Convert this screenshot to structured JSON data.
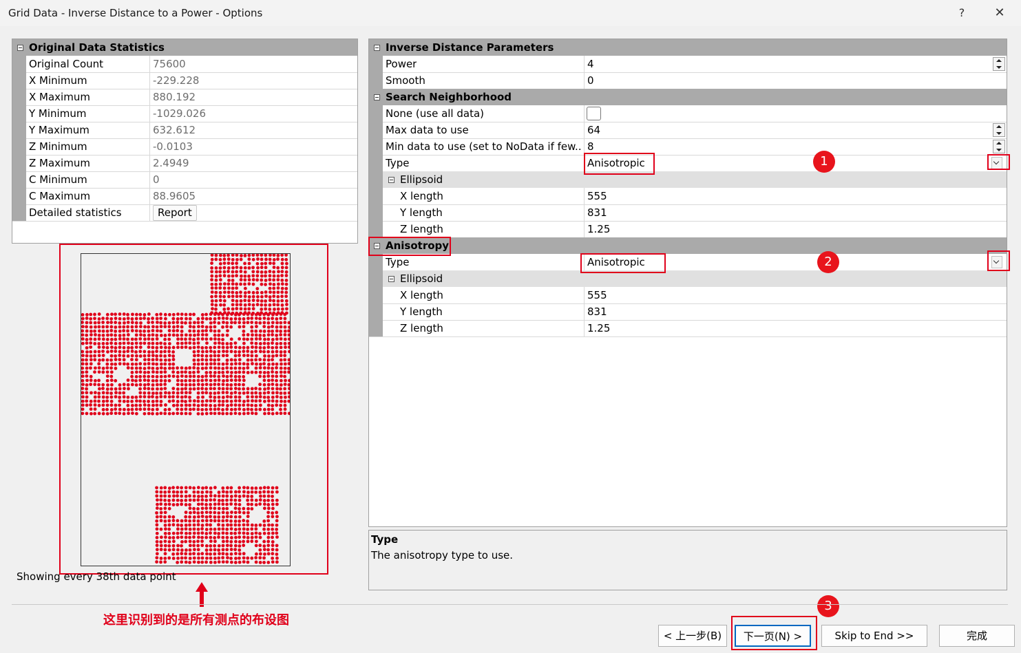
{
  "window": {
    "title": "Grid Data - Inverse Distance to a Power - Options",
    "help": "?",
    "close": "✕"
  },
  "stats": {
    "header": "Original Data Statistics",
    "rows": [
      {
        "label": "Original Count",
        "value": "75600"
      },
      {
        "label": "X Minimum",
        "value": "-229.228"
      },
      {
        "label": "X Maximum",
        "value": "880.192"
      },
      {
        "label": "Y Minimum",
        "value": "-1029.026"
      },
      {
        "label": "Y Maximum",
        "value": "632.612"
      },
      {
        "label": "Z Minimum",
        "value": "-0.0103"
      },
      {
        "label": "Z Maximum",
        "value": "2.4949"
      },
      {
        "label": "C Minimum",
        "value": "0"
      },
      {
        "label": "C Maximum",
        "value": "88.9605"
      }
    ],
    "detailed_label": "Detailed statistics",
    "report_button": "Report"
  },
  "preview": {
    "caption": "Showing every 38th data point",
    "annotation": "这里识别到的是所有测点的布设图",
    "point_color": "#e0001a"
  },
  "params": {
    "idp": {
      "header": "Inverse Distance Parameters",
      "power_label": "Power",
      "power_value": "4",
      "smooth_label": "Smooth",
      "smooth_value": "0"
    },
    "search": {
      "header": "Search Neighborhood",
      "none_label": "None (use all data)",
      "max_label": "Max data to use",
      "max_value": "64",
      "min_label": "Min data to use (set to NoData if few...",
      "min_value": "8",
      "type_label": "Type",
      "type_value": "Anisotropic",
      "ellipsoid_label": "Ellipsoid",
      "x_label": "X length",
      "x_value": "555",
      "y_label": "Y length",
      "y_value": "831",
      "z_label": "Z length",
      "z_value": "1.25"
    },
    "aniso": {
      "header": "Anisotropy",
      "type_label": "Type",
      "type_value": "Anisotropic",
      "ellipsoid_label": "Ellipsoid",
      "x_label": "X length",
      "x_value": "555",
      "y_label": "Y length",
      "y_value": "831",
      "z_label": "Z length",
      "z_value": "1.25"
    }
  },
  "description": {
    "title": "Type",
    "text": "The anisotropy type to use."
  },
  "markers": [
    "1",
    "2",
    "3"
  ],
  "buttons": {
    "back": "< 上一步(B)",
    "next": "下一页(N) >",
    "skip": "Skip to End >>",
    "finish": "完成"
  }
}
